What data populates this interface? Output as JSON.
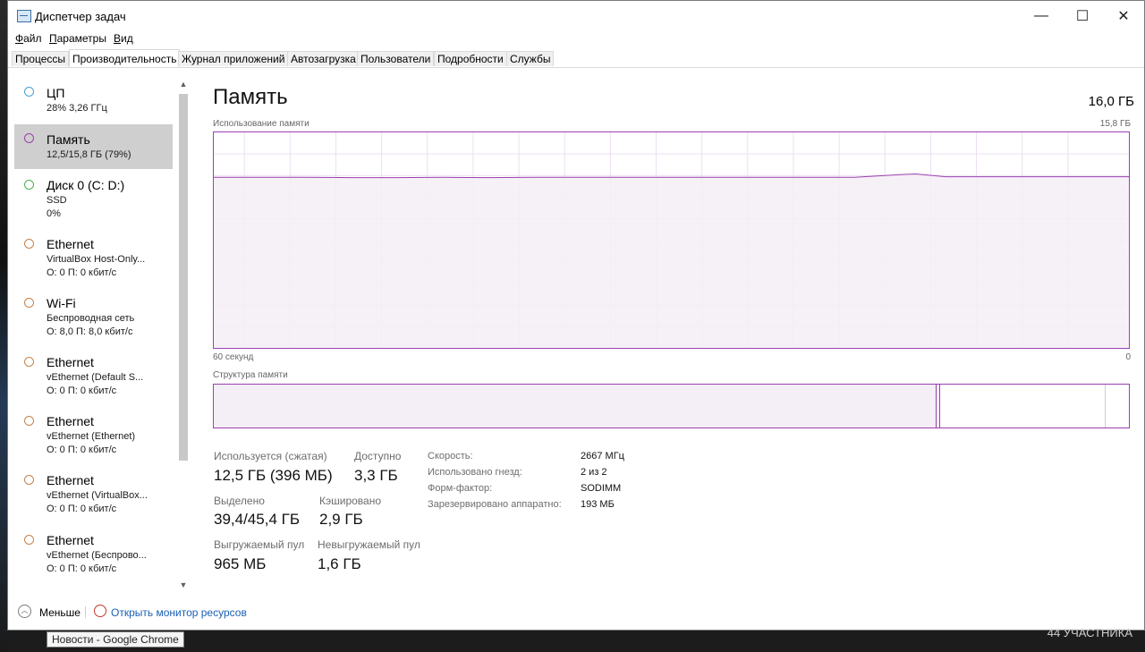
{
  "window": {
    "title": "Диспетчер задач",
    "min_label": "—",
    "max_label": "☐",
    "close_label": "✕"
  },
  "menu": [
    {
      "accel": "Ф",
      "rest": "айл"
    },
    {
      "accel": "П",
      "rest": "араметры"
    },
    {
      "accel": "В",
      "rest": "ид"
    }
  ],
  "tabs": [
    "Процессы",
    "Производительность",
    "Журнал приложений",
    "Автозагрузка",
    "Пользователи",
    "Подробности",
    "Службы"
  ],
  "active_tab": 1,
  "sidebar": {
    "items": [
      {
        "title": "ЦП",
        "line1": "28%  3,26 ГГц",
        "line2": "",
        "circle_color": "#4a9fd8"
      },
      {
        "title": "Память",
        "line1": "12,5/15,8 ГБ (79%)",
        "line2": "",
        "circle_color": "#9b3fb0"
      },
      {
        "title": "Диск 0 (C: D:)",
        "line1": "SSD",
        "line2": "0%",
        "circle_color": "#4caf50"
      },
      {
        "title": "Ethernet",
        "line1": "VirtualBox Host-Only...",
        "line2": "О: 0 П: 0 кбит/с",
        "circle_color": "#c7824a"
      },
      {
        "title": "Wi-Fi",
        "line1": "Беспроводная сеть",
        "line2": "О: 8,0 П: 8,0 кбит/с",
        "circle_color": "#c7824a"
      },
      {
        "title": "Ethernet",
        "line1": "vEthernet (Default S...",
        "line2": "О: 0 П: 0 кбит/с",
        "circle_color": "#c7824a"
      },
      {
        "title": "Ethernet",
        "line1": "vEthernet (Ethernet)",
        "line2": "О: 0 П: 0 кбит/с",
        "circle_color": "#c7824a"
      },
      {
        "title": "Ethernet",
        "line1": "vEthernet (VirtualBox...",
        "line2": "О: 0 П: 0 кбит/с",
        "circle_color": "#c7824a"
      },
      {
        "title": "Ethernet",
        "line1": "vEthernet (Беспрово...",
        "line2": "О: 0 П: 0 кбит/с",
        "circle_color": "#c7824a"
      }
    ],
    "active_index": 1,
    "scroll_up": "▲",
    "scroll_down": "▼"
  },
  "main": {
    "title": "Память",
    "total": "16,0 ГБ",
    "usage_label": "Использование памяти",
    "usage_max": "15,8 ГБ",
    "x_left": "60 секунд",
    "x_right": "0",
    "composition_label": "Структура памяти"
  },
  "chart_data": {
    "type": "area",
    "title": "Использование памяти",
    "x": [
      60,
      57,
      54,
      51,
      48,
      45,
      42,
      39,
      36,
      33,
      30,
      27,
      24,
      21,
      18,
      15,
      14,
      12,
      9,
      6,
      3,
      0
    ],
    "values": [
      12.5,
      12.5,
      12.5,
      12.48,
      12.48,
      12.5,
      12.48,
      12.5,
      12.5,
      12.5,
      12.5,
      12.5,
      12.5,
      12.5,
      12.5,
      12.7,
      12.75,
      12.55,
      12.55,
      12.55,
      12.55,
      12.55
    ],
    "ylim": [
      0,
      15.8
    ],
    "xlim": [
      60,
      0
    ],
    "xlabel": "",
    "ylabel": "",
    "grid": true,
    "series_color": "#9b3fb0",
    "fill_color": "#f4eef6"
  },
  "composition": {
    "used_fraction": 0.79,
    "modified_fraction": 0.004,
    "standby_fraction": 0.181,
    "free_fraction": 0.025,
    "used_color": "#f4eef6",
    "border_color": "#9b3fb0"
  },
  "stats": {
    "in_use_label": "Используется (сжатая)",
    "in_use_value": "12,5 ГБ (396 МБ)",
    "available_label": "Доступно",
    "available_value": "3,3 ГБ",
    "committed_label": "Выделено",
    "committed_value": "39,4/45,4 ГБ",
    "cached_label": "Кэшировано",
    "cached_value": "2,9 ГБ",
    "paged_label": "Выгружаемый пул",
    "paged_value": "965 МБ",
    "nonpaged_label": "Невыгружаемый пул",
    "nonpaged_value": "1,6 ГБ"
  },
  "details": [
    {
      "label": "Скорость:",
      "value": "2667 МГц"
    },
    {
      "label": "Использовано гнезд:",
      "value": "2 из 2"
    },
    {
      "label": "Форм-фактор:",
      "value": "SODIMM"
    },
    {
      "label": "Зарезервировано аппаратно:",
      "value": "193 МБ"
    }
  ],
  "footer": {
    "less_label": "Меньше",
    "less_icon": "chevron-up-circle",
    "monitor_link": "Открыть монитор ресурсов",
    "monitor_icon": "resource-monitor"
  },
  "tooltip": "Новости - Google Chrome",
  "taskbar": {
    "participants": "44 УЧАСТНИКА"
  }
}
